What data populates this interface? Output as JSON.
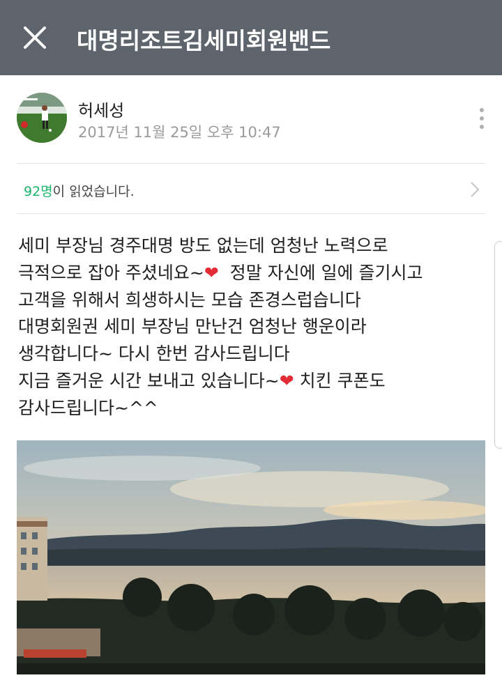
{
  "header": {
    "title": "대명리조트김세미회원밴드",
    "close_icon": "close-icon",
    "bg_color": "#5d646b"
  },
  "post": {
    "author": "허세성",
    "date": "2017년 11월 25일 오후 10:47",
    "more_icon": "more-vertical-icon",
    "read_count": "92명",
    "read_suffix": "이 읽었습니다.",
    "read_chevron_icon": "chevron-right-icon",
    "body": {
      "line1": "세미 부장님 경주대명 방도 없는데 엄청난 노력으로",
      "line2a": "극적으로 잡아 주셨네요~",
      "line2b": "정말 자신에 일에 즐기시고",
      "line3": "고객을 위해서 희생하시는 모습 존경스럽습니다",
      "line4": "대명회원권 세미 부장님 만난건 엄청난 행운이라",
      "line5": "생각합니다~ 다시 한번 감사드립니다",
      "line6a": "지금 즐거운 시간 보내고 있습니다~",
      "line6b": "치킨 쿠폰도",
      "line7": "감사드립니다~^^",
      "heart": "❤"
    },
    "accent_color": "#1ab569"
  }
}
